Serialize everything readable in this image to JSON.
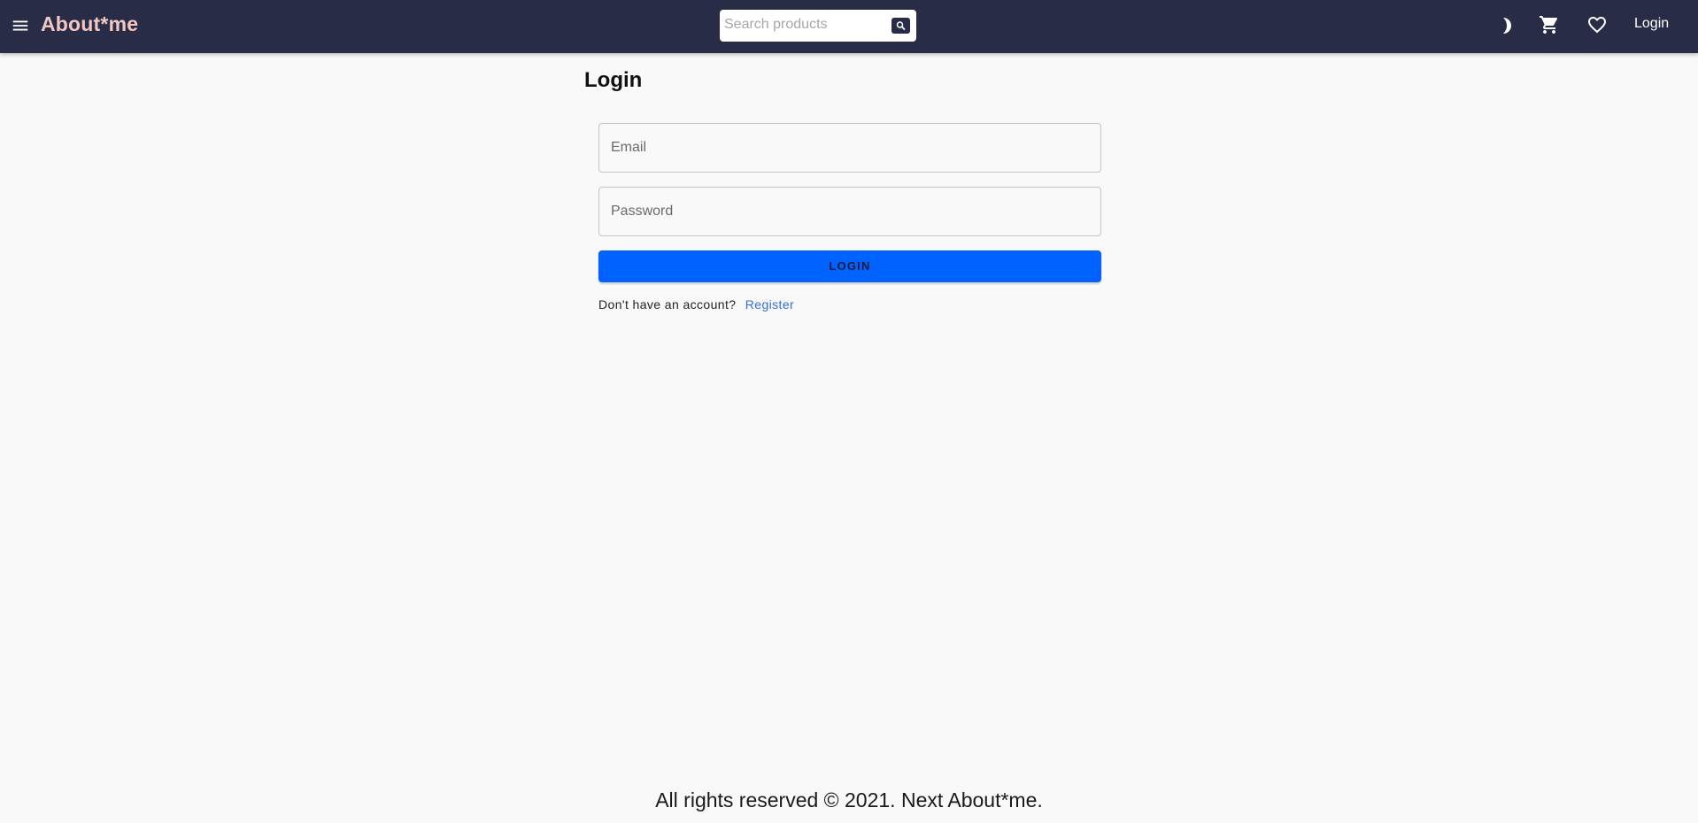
{
  "header": {
    "brand": "About*me",
    "search_placeholder": "Search products",
    "login_label": "Login",
    "icons": [
      "menu-icon",
      "search-icon",
      "moon-icon",
      "cart-icon",
      "heart-icon"
    ],
    "colors": {
      "appbar": "#282c46",
      "brand": "#f3c7c1"
    }
  },
  "main": {
    "title": "Login",
    "email_placeholder": "Email",
    "password_placeholder": "Password",
    "login_button": "LOGIN",
    "register_prompt": "Don't have an account?",
    "register_link": "Register",
    "colors": {
      "button": "#0062ff",
      "link": "#2f6ee3"
    }
  },
  "footer": {
    "text": "All rights reserved © 2021. Next About*me."
  }
}
